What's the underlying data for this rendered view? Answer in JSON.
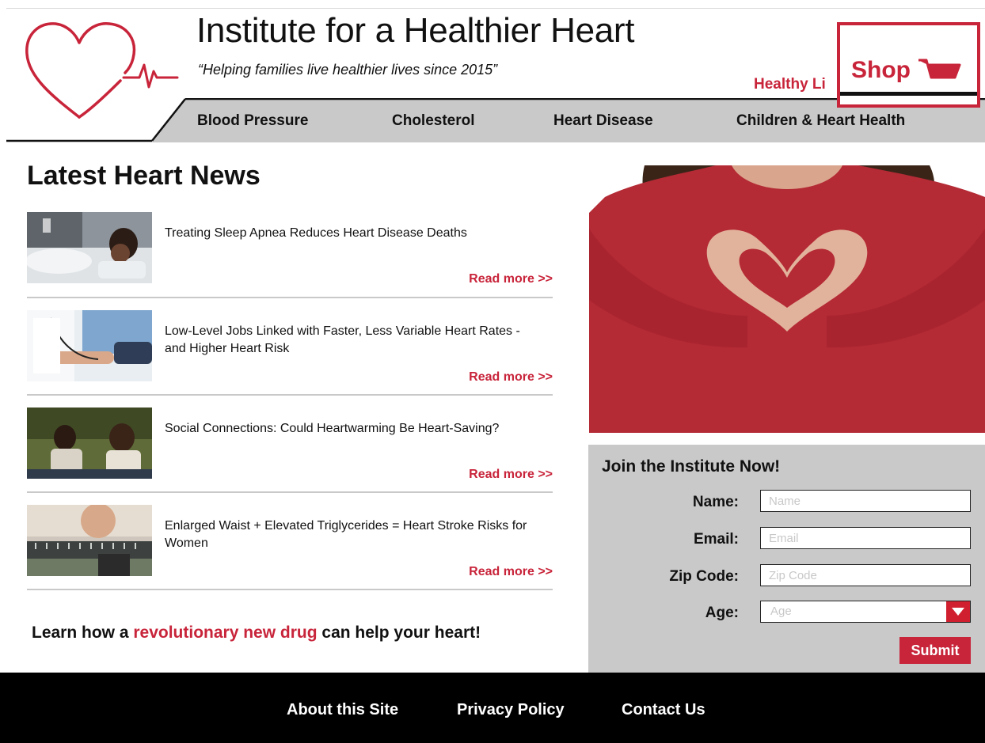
{
  "header": {
    "title": "Institute for a Healthier Heart",
    "tagline": "“Helping families live healthier lives since 2015”",
    "healthy_link": "Healthy Li",
    "shop_label": "Shop"
  },
  "nav": {
    "items": [
      {
        "label": "Blood Pressure"
      },
      {
        "label": "Cholesterol"
      },
      {
        "label": "Heart Disease"
      },
      {
        "label": "Children & Heart Health"
      }
    ]
  },
  "news": {
    "heading": "Latest Heart News",
    "items": [
      {
        "title": "Treating Sleep Apnea Reduces Heart Disease Deaths",
        "link": "Read more >>"
      },
      {
        "title": "Low-Level Jobs Linked with Faster, Less Variable Heart Rates - and Higher Heart Risk",
        "link": "Read more >>"
      },
      {
        "title": "Social Connections: Could Heartwarming Be Heart-Saving?",
        "link": "Read more >>"
      },
      {
        "title": "Enlarged Waist + Elevated Triglycerides = Heart Stroke Risks for Women",
        "link": "Read more >>"
      }
    ]
  },
  "promo": {
    "before": "Learn how a ",
    "highlight": "revolutionary new drug",
    "after": " can help your heart!"
  },
  "form": {
    "title": "Join the Institute Now!",
    "name_label": "Name:",
    "name_placeholder": "Name",
    "email_label": "Email:",
    "email_placeholder": "Email",
    "zip_label": "Zip Code:",
    "zip_placeholder": "Zip Code",
    "age_label": "Age:",
    "age_placeholder": "Age",
    "submit_label": "Submit"
  },
  "footer": {
    "links": [
      {
        "label": "About this Site"
      },
      {
        "label": "Privacy Policy"
      },
      {
        "label": "Contact Us"
      }
    ]
  },
  "colors": {
    "brand_red": "#c8243a",
    "nav_gray": "#c9c9c9",
    "footer_black": "#000000"
  }
}
